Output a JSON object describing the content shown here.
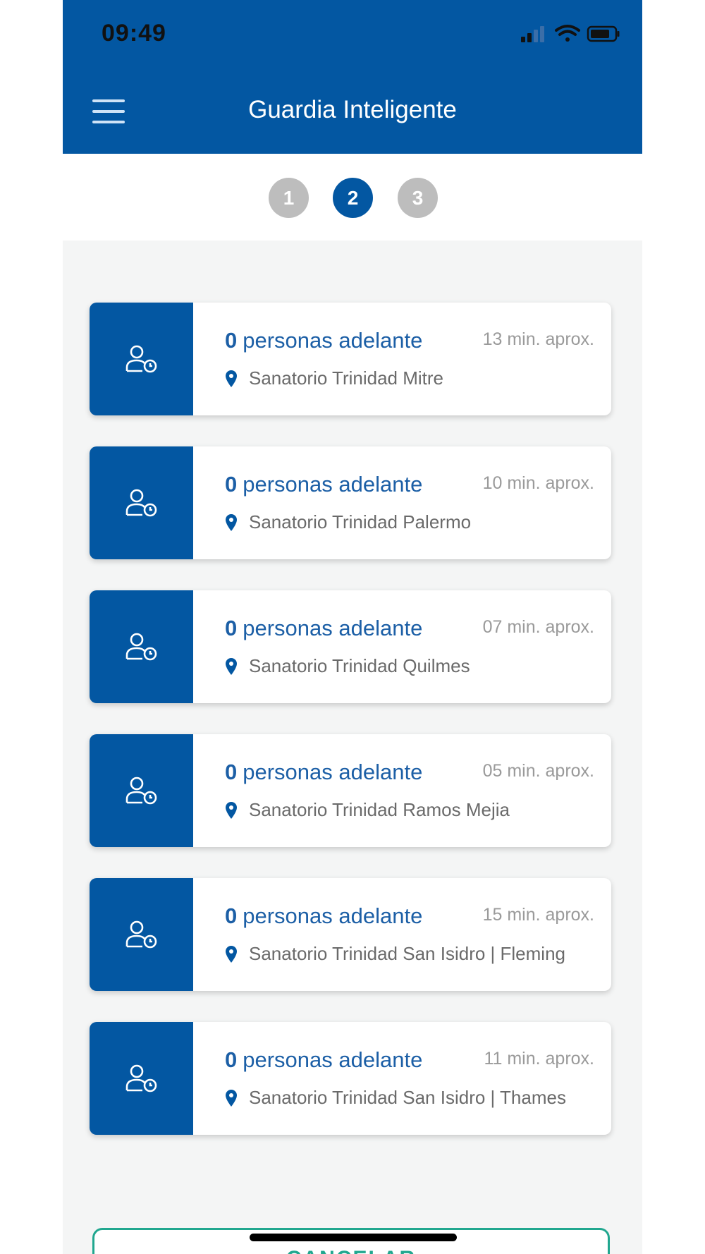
{
  "status_bar": {
    "time": "09:49"
  },
  "header": {
    "title": "Guardia Inteligente",
    "menu_icon": "hamburger-menu-icon"
  },
  "stepper": {
    "steps": [
      "1",
      "2",
      "3"
    ],
    "active_step": "2"
  },
  "colors": {
    "primary": "#0357a2",
    "accent": "#21a78f",
    "inactive_step": "#bdbdbd"
  },
  "cards": [
    {
      "count": "0",
      "label": "personas adelante",
      "eta": "13 min. aprox.",
      "location": "Sanatorio Trinidad Mitre"
    },
    {
      "count": "0",
      "label": "personas adelante",
      "eta": "10 min. aprox.",
      "location": "Sanatorio Trinidad Palermo"
    },
    {
      "count": "0",
      "label": "personas adelante",
      "eta": "07 min. aprox.",
      "location": "Sanatorio Trinidad Quilmes"
    },
    {
      "count": "0",
      "label": "personas adelante",
      "eta": "05 min. aprox.",
      "location": "Sanatorio Trinidad Ramos Mejia"
    },
    {
      "count": "0",
      "label": "personas adelante",
      "eta": "15 min. aprox.",
      "location": "Sanatorio Trinidad San Isidro | Fleming"
    },
    {
      "count": "0",
      "label": "personas adelante",
      "eta": "11 min. aprox.",
      "location": "Sanatorio Trinidad San Isidro | Thames"
    }
  ],
  "footer": {
    "cancel_label": "CANCELAR"
  }
}
